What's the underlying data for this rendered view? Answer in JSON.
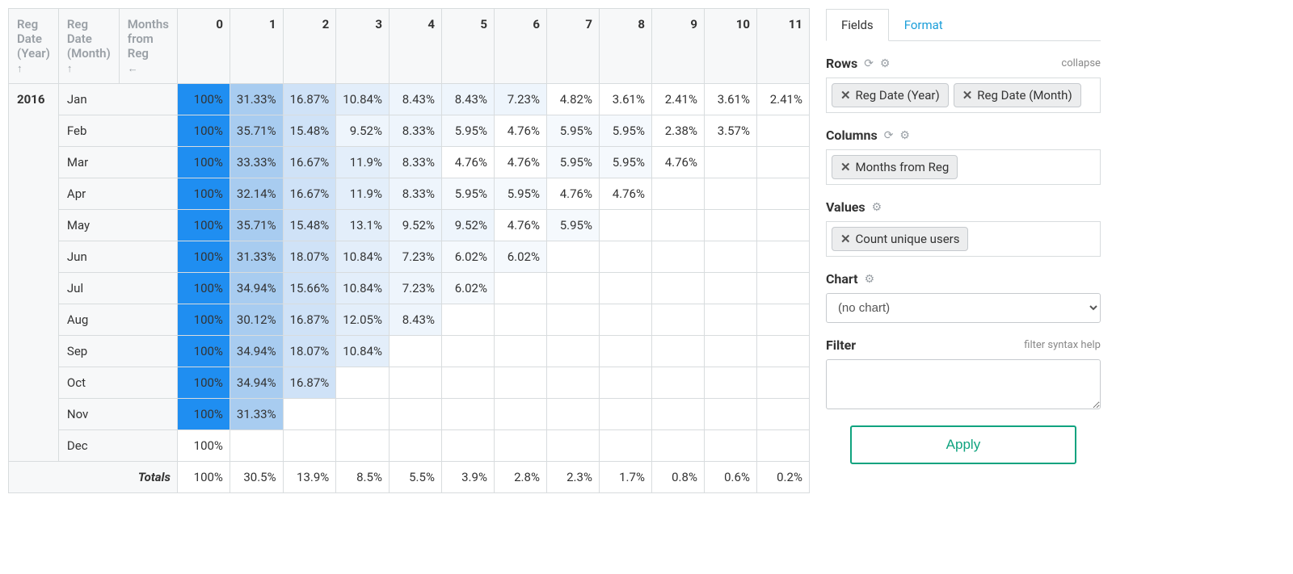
{
  "pivot": {
    "row_headers": [
      "Reg Date (Year)",
      "Reg Date (Month)",
      "Months from Reg"
    ],
    "row_header_sorts": [
      "↑",
      "↑",
      "←"
    ],
    "col_headers": [
      "0",
      "1",
      "2",
      "3",
      "4",
      "5",
      "6",
      "7",
      "8",
      "9",
      "10",
      "11"
    ],
    "year": "2016",
    "months": [
      "Jan",
      "Feb",
      "Mar",
      "Apr",
      "May",
      "Jun",
      "Jul",
      "Aug",
      "Sep",
      "Oct",
      "Nov",
      "Dec"
    ],
    "data": [
      [
        "100%",
        "31.33%",
        "16.87%",
        "10.84%",
        "8.43%",
        "8.43%",
        "7.23%",
        "4.82%",
        "3.61%",
        "2.41%",
        "3.61%",
        "2.41%"
      ],
      [
        "100%",
        "35.71%",
        "15.48%",
        "9.52%",
        "8.33%",
        "5.95%",
        "4.76%",
        "5.95%",
        "5.95%",
        "2.38%",
        "3.57%",
        ""
      ],
      [
        "100%",
        "33.33%",
        "16.67%",
        "11.9%",
        "8.33%",
        "4.76%",
        "4.76%",
        "5.95%",
        "5.95%",
        "4.76%",
        "",
        ""
      ],
      [
        "100%",
        "32.14%",
        "16.67%",
        "11.9%",
        "8.33%",
        "5.95%",
        "5.95%",
        "4.76%",
        "4.76%",
        "",
        "",
        ""
      ],
      [
        "100%",
        "35.71%",
        "15.48%",
        "13.1%",
        "9.52%",
        "9.52%",
        "4.76%",
        "5.95%",
        "",
        "",
        "",
        ""
      ],
      [
        "100%",
        "31.33%",
        "18.07%",
        "10.84%",
        "7.23%",
        "6.02%",
        "6.02%",
        "",
        "",
        "",
        "",
        ""
      ],
      [
        "100%",
        "34.94%",
        "15.66%",
        "10.84%",
        "7.23%",
        "6.02%",
        "",
        "",
        "",
        "",
        "",
        ""
      ],
      [
        "100%",
        "30.12%",
        "16.87%",
        "12.05%",
        "8.43%",
        "",
        "",
        "",
        "",
        "",
        "",
        ""
      ],
      [
        "100%",
        "34.94%",
        "18.07%",
        "10.84%",
        "",
        "",
        "",
        "",
        "",
        "",
        "",
        ""
      ],
      [
        "100%",
        "34.94%",
        "16.87%",
        "",
        "",
        "",
        "",
        "",
        "",
        "",
        "",
        ""
      ],
      [
        "100%",
        "31.33%",
        "",
        "",
        "",
        "",
        "",
        "",
        "",
        "",
        "",
        ""
      ],
      [
        "100%",
        "",
        "",
        "",
        "",
        "",
        "",
        "",
        "",
        "",
        "",
        ""
      ]
    ],
    "totals_label": "Totals",
    "totals": [
      "100%",
      "30.5%",
      "13.9%",
      "8.5%",
      "5.5%",
      "3.9%",
      "2.8%",
      "2.3%",
      "1.7%",
      "0.8%",
      "0.6%",
      "0.2%"
    ]
  },
  "config": {
    "tabs": {
      "fields": "Fields",
      "format": "Format"
    },
    "rows": {
      "title": "Rows",
      "collapse": "collapse",
      "pills": [
        "Reg Date (Year)",
        "Reg Date (Month)"
      ]
    },
    "columns": {
      "title": "Columns",
      "pills": [
        "Months from Reg"
      ]
    },
    "values": {
      "title": "Values",
      "pills": [
        "Count unique users"
      ]
    },
    "chart": {
      "title": "Chart",
      "selected": "(no chart)"
    },
    "filter": {
      "title": "Filter",
      "help": "filter syntax help",
      "value": ""
    },
    "apply": "Apply"
  }
}
